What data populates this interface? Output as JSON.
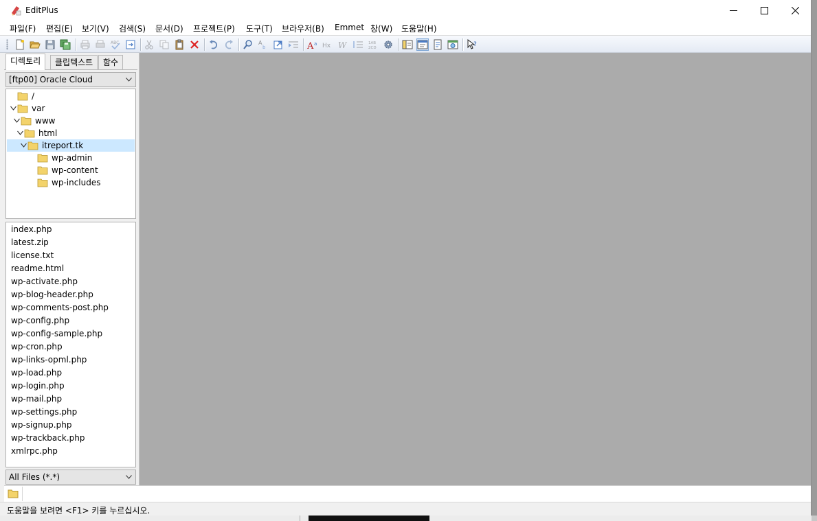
{
  "window": {
    "title": "EditPlus",
    "icon": "editplus-app-icon",
    "controls": [
      "minimize-icon",
      "maximize-icon",
      "close-icon"
    ]
  },
  "menu": [
    {
      "label": "파일(F)"
    },
    {
      "label": "편집(E)"
    },
    {
      "label": "보기(V)"
    },
    {
      "label": "검색(S)"
    },
    {
      "label": "문서(D)"
    },
    {
      "label": "프로젝트(P)"
    },
    {
      "label": "도구(T)"
    },
    {
      "label": "브라우저(B)"
    },
    {
      "label": "Emmet"
    },
    {
      "label": "창(W)"
    },
    {
      "label": "도움말(H)"
    }
  ],
  "toolbar": {
    "buttons": [
      "new-file-icon",
      "open-icon",
      "save-icon",
      "save-all-icon",
      "print-preview-icon",
      "print-icon",
      "spell-check-icon",
      "sync-icon",
      "cut-icon",
      "copy-icon",
      "paste-icon",
      "delete-icon",
      "undo-icon",
      "redo-icon",
      "find-icon",
      "replace-icon",
      "goto-icon",
      "indent-icon",
      "font-icon",
      "hex-icon",
      "word-wrap-icon",
      "line-number-icon",
      "column-icon",
      "preferences-icon",
      "directory-window-icon",
      "output-window-icon",
      "cliptext-icon",
      "browser-icon",
      "help-context-icon"
    ],
    "pressed": [
      "output-window-icon"
    ]
  },
  "sidebar": {
    "tabs": [
      {
        "label": "디렉토리",
        "active": true
      },
      {
        "label": "클립텍스트",
        "active": false
      },
      {
        "label": "함수",
        "active": false
      }
    ],
    "location": "[ftp00] Oracle Cloud",
    "tree": [
      {
        "label": "/",
        "depth": 0,
        "expanded": false,
        "has_children": false
      },
      {
        "label": "var",
        "depth": 0,
        "expanded": true,
        "has_children": true
      },
      {
        "label": "www",
        "depth": 1,
        "expanded": true,
        "has_children": true
      },
      {
        "label": "html",
        "depth": 2,
        "expanded": true,
        "has_children": true
      },
      {
        "label": "itreport.tk",
        "depth": 3,
        "expanded": true,
        "has_children": true,
        "selected": true
      },
      {
        "label": "wp-admin",
        "depth": 4,
        "expanded": false,
        "has_children": false
      },
      {
        "label": "wp-content",
        "depth": 4,
        "expanded": false,
        "has_children": false
      },
      {
        "label": "wp-includes",
        "depth": 4,
        "expanded": false,
        "has_children": false
      }
    ],
    "files": [
      "index.php",
      "latest.zip",
      "license.txt",
      "readme.html",
      "wp-activate.php",
      "wp-blog-header.php",
      "wp-comments-post.php",
      "wp-config.php",
      "wp-config-sample.php",
      "wp-cron.php",
      "wp-links-opml.php",
      "wp-load.php",
      "wp-login.php",
      "wp-mail.php",
      "wp-settings.php",
      "wp-signup.php",
      "wp-trackback.php",
      "xmlrpc.php"
    ],
    "filter": "All Files (*.*)"
  },
  "status": {
    "text": "도움말을 보려면 <F1> 키를 누르십시오."
  },
  "colors": {
    "editor_bg": "#ababab",
    "selection": "#cce8ff",
    "folder": "#f3d36b"
  }
}
